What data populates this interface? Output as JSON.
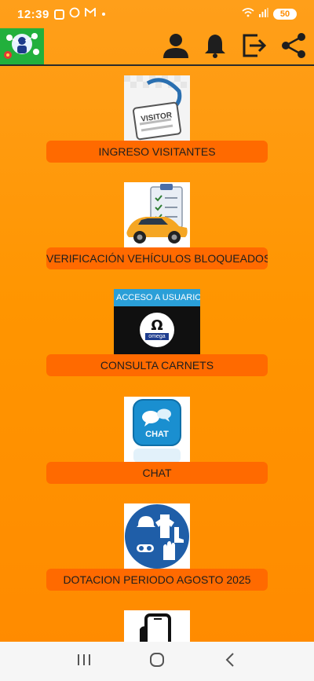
{
  "status_bar": {
    "time": "12:39",
    "battery": "50"
  },
  "app_bar": {
    "actions": [
      "profile-icon",
      "notifications-icon",
      "logout-icon",
      "share-icon"
    ]
  },
  "menu": {
    "items": [
      {
        "label": "INGRESO VISITANTES",
        "image": "visitor-badge-icon"
      },
      {
        "label": "VERIFICACIÓN VEHÍCULOS BLOQUEADOS",
        "image": "vehicle-checklist-icon"
      },
      {
        "label": "CONSULTA CARNETS",
        "image": "omega-access-icon",
        "image_caption": "ACCESO A USUARIO",
        "image_brand": "omega"
      },
      {
        "label": "CHAT",
        "image": "chat-icon",
        "image_text": "CHAT"
      },
      {
        "label": "DOTACION PERIODO AGOSTO 2025",
        "image": "safety-equipment-icon"
      },
      {
        "label": "",
        "image": "mobile-phone-icon"
      }
    ]
  },
  "colors": {
    "background": "#ff9500",
    "button": "#ff6a00",
    "app_logo_bg": "#1fae3a"
  }
}
